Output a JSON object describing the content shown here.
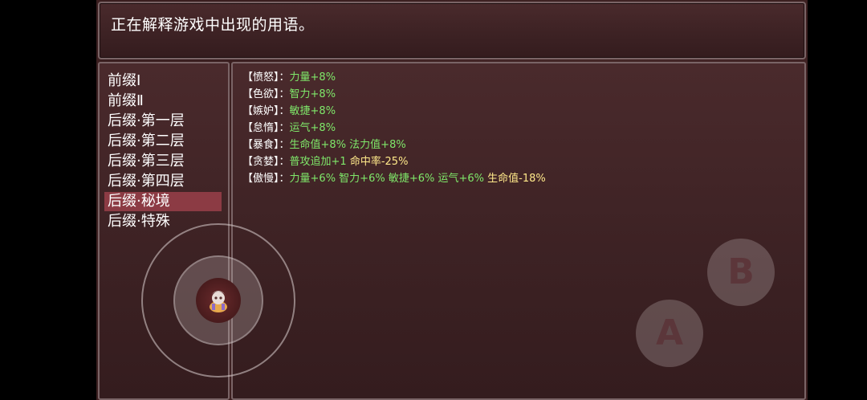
{
  "message": "正在解释游戏中出现的用语。",
  "categories": [
    {
      "label": "前缀Ⅰ"
    },
    {
      "label": "前缀Ⅱ"
    },
    {
      "label": "后缀·第一层"
    },
    {
      "label": "后缀·第二层"
    },
    {
      "label": "后缀·第三层"
    },
    {
      "label": "后缀·第四层"
    },
    {
      "label": "后缀·秘境"
    },
    {
      "label": "后缀·特殊"
    }
  ],
  "selected_category": "后缀·秘境",
  "details": [
    {
      "name": "【愤怒】",
      "sep": "：",
      "effects": [
        {
          "text": "力量+8%",
          "color": "green"
        }
      ]
    },
    {
      "name": "【色欲】",
      "sep": "：",
      "effects": [
        {
          "text": "智力+8%",
          "color": "green"
        }
      ]
    },
    {
      "name": "【嫉妒】",
      "sep": "：",
      "effects": [
        {
          "text": "敏捷+8%",
          "color": "green"
        }
      ]
    },
    {
      "name": "【怠惰】",
      "sep": "：",
      "effects": [
        {
          "text": "运气+8%",
          "color": "green"
        }
      ]
    },
    {
      "name": "【暴食】",
      "sep": "：",
      "effects": [
        {
          "text": "生命值+8% 法力值+8%",
          "color": "green"
        }
      ]
    },
    {
      "name": "【贪婪】",
      "sep": "：",
      "effects": [
        {
          "text": "普攻追加+1",
          "color": "green"
        },
        {
          "text": " 命中率-25%",
          "color": "yellow"
        }
      ]
    },
    {
      "name": "【傲慢】",
      "sep": "：",
      "effects": [
        {
          "text": "力量+6% 智力+6% 敏捷+6% 运气+6%",
          "color": "green"
        },
        {
          "text": " 生命值-18%",
          "color": "yellow"
        }
      ]
    }
  ],
  "controls": {
    "a_label": "A",
    "b_label": "B",
    "joystick_icon": "character-sprite-icon"
  },
  "colors": {
    "positive": "#7fe86a",
    "negative": "#ffe98a",
    "selection": "#8c3b44",
    "panel_border": "#7a6466"
  }
}
